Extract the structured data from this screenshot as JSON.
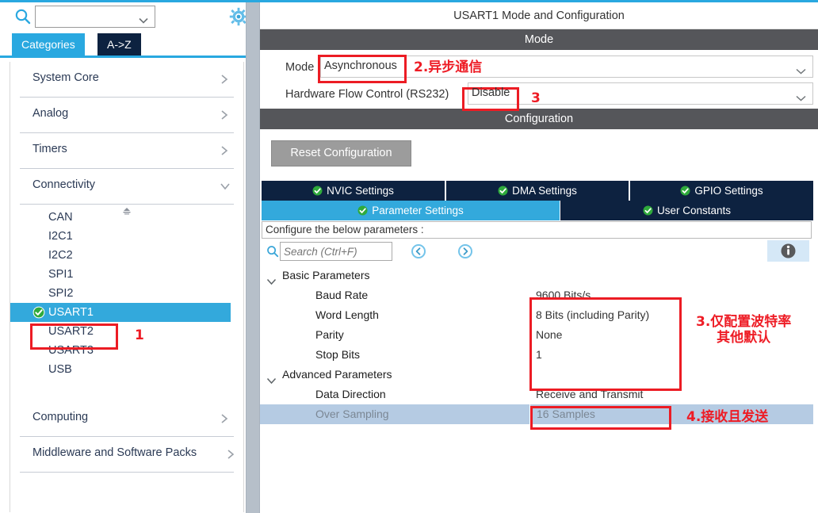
{
  "theme": {
    "accent_blue": "#29a8e0",
    "tab_navy": "#0d2240",
    "section_gray": "#55565a",
    "selected_row": "#b5cbe3",
    "annotation_red": "#ee1c25",
    "reset_btn_gray": "#9c9c9c",
    "green_check": "#33a02c"
  },
  "left_panel": {
    "search": {
      "value": "",
      "placeholder": ""
    },
    "gear_icon": "gear-icon",
    "tabs": [
      {
        "label": "Categories",
        "active": true
      },
      {
        "label": "A->Z",
        "active": false
      }
    ],
    "categories": [
      {
        "label": "System Core",
        "expanded": false,
        "chevron": "chevron-right-icon"
      },
      {
        "label": "Analog",
        "expanded": false,
        "chevron": "chevron-right-icon"
      },
      {
        "label": "Timers",
        "expanded": false,
        "chevron": "chevron-right-icon"
      },
      {
        "label": "Connectivity",
        "expanded": true,
        "chevron": "chevron-down-icon"
      }
    ],
    "connectivity_items": [
      {
        "label": "CAN",
        "selected": false,
        "configured": false
      },
      {
        "label": "I2C1",
        "selected": false,
        "configured": false
      },
      {
        "label": "I2C2",
        "selected": false,
        "configured": false
      },
      {
        "label": "SPI1",
        "selected": false,
        "configured": false
      },
      {
        "label": "SPI2",
        "selected": false,
        "configured": false
      },
      {
        "label": "USART1",
        "selected": true,
        "configured": true
      },
      {
        "label": "USART2",
        "selected": false,
        "configured": false
      },
      {
        "label": "USART3",
        "selected": false,
        "configured": false
      },
      {
        "label": "USB",
        "selected": false,
        "configured": false
      }
    ],
    "bottom_categories": [
      {
        "label": "Computing",
        "expanded": false,
        "chevron": "chevron-right-icon"
      },
      {
        "label": "Middleware and Software Packs",
        "expanded": false,
        "chevron": "chevron-right-icon"
      }
    ]
  },
  "right_panel": {
    "title": "USART1 Mode and Configuration",
    "mode_section": {
      "header": "Mode",
      "rows": [
        {
          "label": "Mode",
          "value": "Asynchronous"
        },
        {
          "label": "Hardware Flow Control (RS232)",
          "value": "Disable"
        }
      ]
    },
    "configuration_section": {
      "header": "Configuration",
      "reset_button": "Reset Configuration",
      "tabs_row1": [
        {
          "label": "NVIC Settings",
          "active": false,
          "has_check": true
        },
        {
          "label": "DMA Settings",
          "active": false,
          "has_check": true
        },
        {
          "label": "GPIO Settings",
          "active": false,
          "has_check": true
        }
      ],
      "tabs_row2": [
        {
          "label": "Parameter Settings",
          "active": true,
          "has_check": true
        },
        {
          "label": "User Constants",
          "active": false,
          "has_check": true
        }
      ],
      "configure_hint": "Configure the below parameters :",
      "search": {
        "value": "",
        "placeholder": "Search (Ctrl+F)"
      },
      "nav_back_icon": "nav-back-icon",
      "nav_forward_icon": "nav-forward-icon",
      "info_icon": "info-icon",
      "parameters": [
        {
          "type": "group",
          "name": "Basic Parameters",
          "value": "",
          "expanded": true,
          "selected": false
        },
        {
          "type": "param",
          "name": "Baud Rate",
          "value": "9600 Bits/s",
          "selected": false
        },
        {
          "type": "param",
          "name": "Word Length",
          "value": "8 Bits (including Parity)",
          "selected": false
        },
        {
          "type": "param",
          "name": "Parity",
          "value": "None",
          "selected": false
        },
        {
          "type": "param",
          "name": "Stop Bits",
          "value": "1",
          "selected": false
        },
        {
          "type": "group",
          "name": "Advanced Parameters",
          "value": "",
          "expanded": true,
          "selected": false
        },
        {
          "type": "param",
          "name": "Data Direction",
          "value": "Receive and Transmit",
          "selected": false
        },
        {
          "type": "param",
          "name": "Over Sampling",
          "value": "16 Samples",
          "selected": true
        }
      ]
    }
  },
  "annotations": [
    {
      "id": "a1",
      "text": "1"
    },
    {
      "id": "a2",
      "text": "2.异步通信"
    },
    {
      "id": "a3",
      "text": "3"
    },
    {
      "id": "a4",
      "line1": "3.仅配置波特率",
      "line2": "其他默认"
    },
    {
      "id": "a5",
      "text": "4.接收且发送"
    }
  ]
}
